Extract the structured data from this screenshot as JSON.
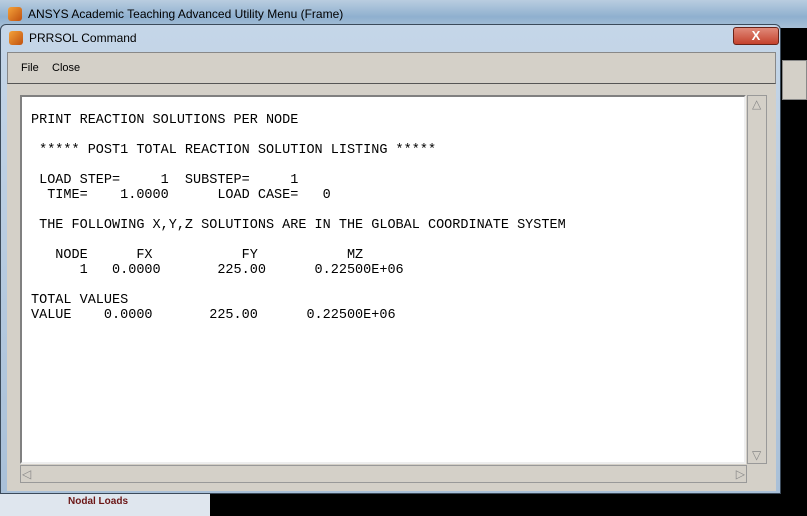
{
  "parent_window": {
    "title": "ANSYS Academic Teaching Advanced Utility Menu (Frame)",
    "tree_item": "Nodal Loads"
  },
  "dialog": {
    "title": "PRRSOL  Command",
    "close_label": "X"
  },
  "menu": {
    "items": [
      "File",
      "Close"
    ]
  },
  "output_lines": [
    "PRINT REACTION SOLUTIONS PER NODE",
    "",
    " ***** POST1 TOTAL REACTION SOLUTION LISTING *****",
    "",
    " LOAD STEP=     1  SUBSTEP=     1",
    "  TIME=    1.0000      LOAD CASE=   0",
    "",
    " THE FOLLOWING X,Y,Z SOLUTIONS ARE IN THE GLOBAL COORDINATE SYSTEM",
    "",
    "   NODE      FX           FY           MZ",
    "      1   0.0000       225.00      0.22500E+06",
    "",
    "TOTAL VALUES",
    "VALUE    0.0000       225.00      0.22500E+06"
  ]
}
